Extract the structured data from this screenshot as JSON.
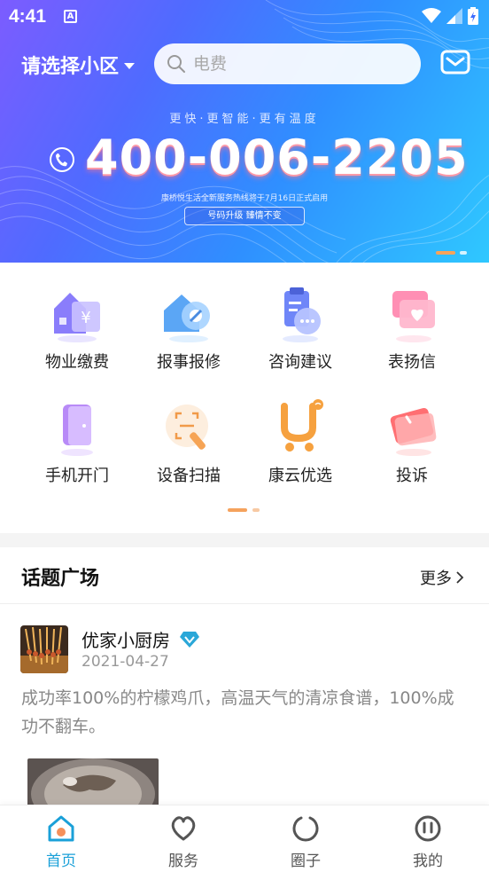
{
  "status_bar": {
    "time": "4:41",
    "notification_letter": "A"
  },
  "header": {
    "community_select": "请选择小区",
    "search_placeholder": "电费"
  },
  "banner": {
    "slogan": "更快·更智能·更有温度",
    "hotline": "400-006-2205",
    "notice": "康桥悦生活全新服务热线将于7月16日正式启用",
    "badge": "号码升级   臻情不变"
  },
  "services": [
    {
      "label": "物业缴费",
      "icon": "property-fee-icon"
    },
    {
      "label": "报事报修",
      "icon": "repair-icon"
    },
    {
      "label": "咨询建议",
      "icon": "consult-icon"
    },
    {
      "label": "表扬信",
      "icon": "praise-letter-icon"
    },
    {
      "label": "手机开门",
      "icon": "door-open-icon"
    },
    {
      "label": "设备扫描",
      "icon": "scan-icon"
    },
    {
      "label": "康云优选",
      "icon": "shop-cart-icon"
    },
    {
      "label": "投诉",
      "icon": "complaint-icon"
    }
  ],
  "topics": {
    "title": "话题广场",
    "more": "更多",
    "post": {
      "author": "优家小厨房",
      "date": "2021-04-27",
      "text": "成功率100%的柠檬鸡爪，高温天气的清凉食谱，100%成功不翻车。"
    }
  },
  "bottom_nav": [
    {
      "label": "首页",
      "active": true
    },
    {
      "label": "服务",
      "active": false
    },
    {
      "label": "圈子",
      "active": false
    },
    {
      "label": "我的",
      "active": false
    }
  ],
  "colors": {
    "accent": "#1aa0d8",
    "inactive": "#555555",
    "pager_active": "#f5a25d"
  }
}
